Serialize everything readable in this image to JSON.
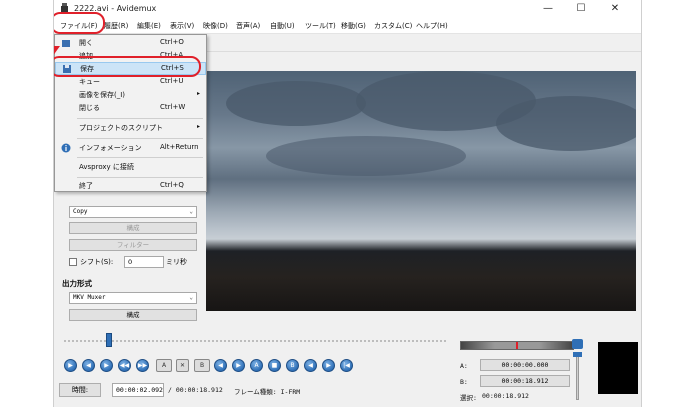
{
  "window": {
    "title": "2222.avi - Avidemux",
    "min_icon": "minimize-icon",
    "max_icon": "maximize-icon",
    "close_icon": "close-icon",
    "min_glyph": "—",
    "max_glyph": "☐",
    "close_glyph": "✕"
  },
  "menubar": [
    {
      "label": "ファイル(F)"
    },
    {
      "label": "履歴(R)"
    },
    {
      "label": "編集(E)"
    },
    {
      "label": "表示(V)"
    },
    {
      "label": "映像(D)"
    },
    {
      "label": "音声(A)"
    },
    {
      "label": "自動(U)"
    },
    {
      "label": "ツール(T)"
    },
    {
      "label": "移動(G)"
    },
    {
      "label": "カスタム(C)"
    },
    {
      "label": "ヘルプ(H)"
    }
  ],
  "file_menu": {
    "items": [
      {
        "label": "開く",
        "shortcut": "Ctrl+O",
        "icon": "open-icon"
      },
      {
        "label": "追加",
        "shortcut": "Ctrl+A",
        "icon": ""
      },
      {
        "label": "保存",
        "shortcut": "Ctrl+S",
        "icon": "save-icon",
        "highlighted": true
      },
      {
        "label": "キュー",
        "shortcut": "Ctrl+U",
        "icon": ""
      },
      {
        "label": "画像を保存(_I)",
        "shortcut": "",
        "submenu": true
      },
      {
        "label": "閉じる",
        "shortcut": "Ctrl+W"
      },
      {
        "label": "プロジェクトのスクリプト",
        "shortcut": "",
        "submenu": true
      },
      {
        "label": "インフォメーション",
        "shortcut": "Alt+Return",
        "icon": "info-icon"
      },
      {
        "label": "Avsproxy に接続",
        "shortcut": ""
      },
      {
        "label": "終了",
        "shortcut": "Ctrl+Q"
      }
    ],
    "submenu_glyph": "▸"
  },
  "left_panel": {
    "audio_codec_value": "Copy",
    "configure_label": "構成",
    "filters_label": "フィルター",
    "shift_label": "シフト(S):",
    "shift_value": "0",
    "shift_unit": "ミリ秒",
    "output_format_title": "出力形式",
    "container_value": "MKV Muxer",
    "container_configure_label": "構成",
    "select_arrow": "⌄"
  },
  "playback": {
    "seek_position_fraction": 0.11,
    "time_button_label": "時間:",
    "current_time": "00:00:02.092",
    "total_time": "/ 00:00:18.912",
    "frame_type": "フレーム種類: I-FRM"
  },
  "ab_markers": {
    "a_label": "A:",
    "a_time": "00:00:00.000",
    "b_label": "B:",
    "b_time": "00:00:18.912",
    "selection_label": "選択:",
    "selection_time": "00:00:18.912"
  },
  "colors": {
    "annotation": "#e0202a",
    "highlight": "#cce4f7",
    "button_blue": "#2f6fb6"
  }
}
